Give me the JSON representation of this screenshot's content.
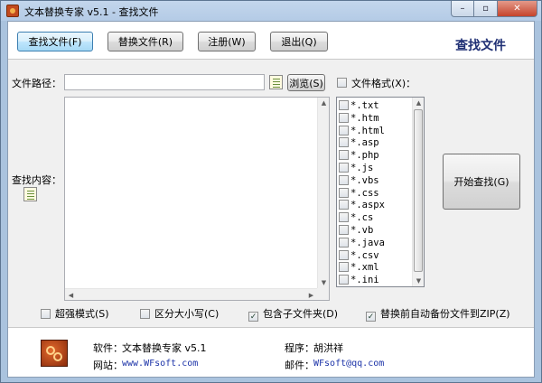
{
  "window": {
    "title": "文本替换专家 v5.1 - 查找文件",
    "min_glyph": "–",
    "max_glyph": "▫",
    "close_glyph": "✕"
  },
  "toolbar": {
    "find_label": "查找文件(F)",
    "replace_label": "替换文件(R)",
    "register_label": "注册(W)",
    "exit_label": "退出(Q)"
  },
  "heading": "查找文件",
  "form": {
    "filepath_label": "文件路径：",
    "filepath_value": "",
    "browse_label": "浏览(S)",
    "content_label": "查找内容：",
    "content_value": "",
    "format_label": "文件格式(X)：",
    "format_checked": false
  },
  "file_types": [
    {
      "label": "*.txt",
      "checked": false
    },
    {
      "label": "*.htm",
      "checked": false
    },
    {
      "label": "*.html",
      "checked": false
    },
    {
      "label": "*.asp",
      "checked": false
    },
    {
      "label": "*.php",
      "checked": false
    },
    {
      "label": "*.js",
      "checked": false
    },
    {
      "label": "*.vbs",
      "checked": false
    },
    {
      "label": "*.css",
      "checked": false
    },
    {
      "label": "*.aspx",
      "checked": false
    },
    {
      "label": "*.cs",
      "checked": false
    },
    {
      "label": "*.vb",
      "checked": false
    },
    {
      "label": "*.java",
      "checked": false
    },
    {
      "label": "*.csv",
      "checked": false
    },
    {
      "label": "*.xml",
      "checked": false
    },
    {
      "label": "*.ini",
      "checked": false
    }
  ],
  "start_label": "开始查找(G)",
  "options": {
    "strong_mode": {
      "label": "超强模式(S)",
      "checked": false
    },
    "case_sensitive": {
      "label": "区分大小写(C)",
      "checked": false
    },
    "include_subfolders": {
      "label": "包含子文件夹(D)",
      "checked": true
    },
    "backup_zip": {
      "label": "替换前自动备份文件到ZIP(Z)",
      "checked": true
    }
  },
  "footer": {
    "software_label": "软件：",
    "software_value": "文本替换专家 v5.1",
    "website_label": "网站：",
    "website_value": "www.WFsoft.com",
    "author_label": "程序：",
    "author_value": "胡洪祥",
    "email_label": "邮件：",
    "email_value": "WFsoft@qq.com"
  }
}
